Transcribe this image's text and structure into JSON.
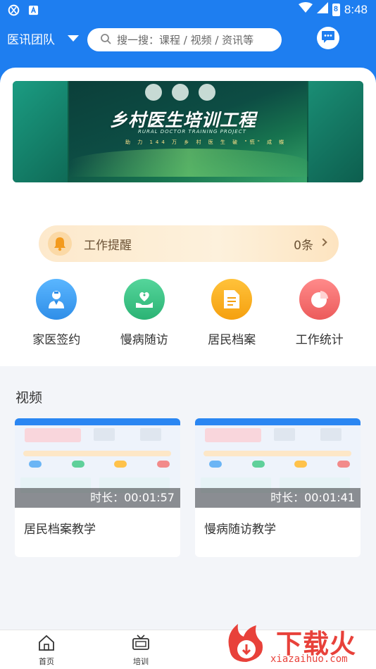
{
  "status_bar": {
    "time": "8:48",
    "battery_label": "8"
  },
  "header": {
    "team_label": "医讯团队",
    "search_placeholder": "搜一搜：课程 / 视频 / 资讯等"
  },
  "banner": {
    "title": "乡村医生培训工程",
    "subtitle": "RURAL DOCTOR TRAINING PROJECT",
    "tagline": "助 力 144 万 乡 村 医 生 破 \"慌\" 成 蝶"
  },
  "reminder": {
    "label": "工作提醒",
    "count": "0条"
  },
  "quick_actions": [
    {
      "label": "家医签约",
      "icon": "doctor-icon",
      "color": "#3a9cf0"
    },
    {
      "label": "慢病随访",
      "icon": "heart-hand-icon",
      "color": "#37c27f"
    },
    {
      "label": "居民档案",
      "icon": "document-icon",
      "color": "#f8a51d"
    },
    {
      "label": "工作统计",
      "icon": "pie-chart-icon",
      "color": "#f16b6b"
    }
  ],
  "videos": {
    "section_title": "视频",
    "items": [
      {
        "title": "居民档案教学",
        "duration": "时长：00:01:57"
      },
      {
        "title": "慢病随访教学",
        "duration": "时长：00:01:41"
      }
    ]
  },
  "bottom_nav": [
    {
      "label": "首页",
      "icon": "home-icon"
    },
    {
      "label": "培训",
      "icon": "tv-icon"
    }
  ],
  "watermark": {
    "text": "下载火",
    "url": "xiazaihuo.com"
  },
  "colors": {
    "primary": "#1e7ef0",
    "reminder_bg": "#fde9cc",
    "watermark": "#e8413a"
  }
}
